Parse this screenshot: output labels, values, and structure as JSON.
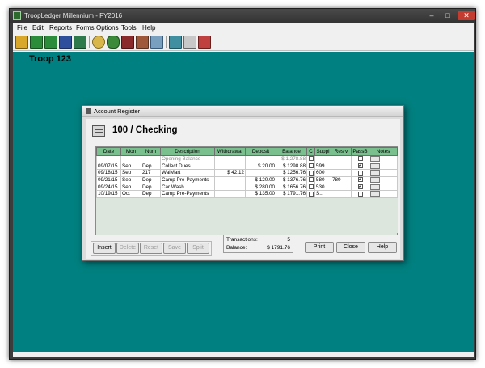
{
  "app": {
    "title": "TroopLedger Millennium - FY2016",
    "menu": [
      "File",
      "Edit",
      "Reports",
      "Forms",
      "Options",
      "Tools",
      "Help"
    ],
    "toolbar_icons": [
      "folder-open-icon",
      "save-icon",
      "save-all-icon",
      "accounts-icon",
      "calendar-icon",
      "money-bag-icon",
      "scout-icon",
      "leader-icon",
      "tools-icon",
      "handshake-icon",
      "notebook-icon",
      "grid-icon",
      "report-icon"
    ],
    "troop_label": "Troop 123"
  },
  "dialog": {
    "title": "Account Register",
    "account_name": "100 / Checking",
    "columns": [
      "Date",
      "Mon",
      "Num",
      "Description",
      "Withdrawal",
      "Deposit",
      "Balance",
      "C",
      "Suppl",
      "Resrv",
      "PassB",
      "Notes"
    ],
    "rows": [
      {
        "date": "",
        "mon": "",
        "num": "",
        "description": "Opening Balance",
        "withdrawal": "",
        "deposit": "",
        "balance": "$ 1,278.88",
        "c": false,
        "suppl": "",
        "resrv": "",
        "passb": false,
        "opening": true
      },
      {
        "date": "09/07/15",
        "mon": "Sep",
        "num": "Dep",
        "description": "Collect Dues",
        "withdrawal": "",
        "deposit": "$ 20.00",
        "balance": "$ 1298.88",
        "c": false,
        "suppl": "599",
        "resrv": "",
        "passb": true,
        "opening": false
      },
      {
        "date": "09/18/15",
        "mon": "Sep",
        "num": "217",
        "description": "WalMart",
        "withdrawal": "$ 42.12",
        "deposit": "",
        "balance": "$ 1256.76",
        "c": false,
        "suppl": "600",
        "resrv": "",
        "passb": false,
        "opening": false
      },
      {
        "date": "09/21/15",
        "mon": "Sep",
        "num": "Dep",
        "description": "Camp Pre-Payments",
        "withdrawal": "",
        "deposit": "$ 120.00",
        "balance": "$ 1376.76",
        "c": false,
        "suppl": "580",
        "resrv": "780",
        "passb": true,
        "opening": false
      },
      {
        "date": "09/24/15",
        "mon": "Sep",
        "num": "Dep",
        "description": "Car Wash",
        "withdrawal": "",
        "deposit": "$ 280.00",
        "balance": "$ 1656.76",
        "c": false,
        "suppl": "530",
        "resrv": "",
        "passb": true,
        "opening": false
      },
      {
        "date": "10/19/15",
        "mon": "Oct",
        "num": "Dep",
        "description": "Camp Pre-Payments",
        "withdrawal": "",
        "deposit": "$ 135.00",
        "balance": "$ 1791.76",
        "c": false,
        "suppl": "S...",
        "resrv": "",
        "passb": false,
        "opening": false
      }
    ],
    "edit_buttons": {
      "insert": "Insert",
      "delete": "Delete",
      "reset": "Reset",
      "save": "Save",
      "split": "Split"
    },
    "summary": {
      "transactions_label": "Transactions:",
      "transactions_value": "5",
      "balance_label": "Balance:",
      "balance_value": "$ 1791.76"
    },
    "action_buttons": {
      "print": "Print",
      "close": "Close",
      "help": "Help"
    }
  },
  "colors": {
    "workspace": "#008080",
    "grid_header": "#7abf8e",
    "grid_body": "#dde6dd"
  }
}
